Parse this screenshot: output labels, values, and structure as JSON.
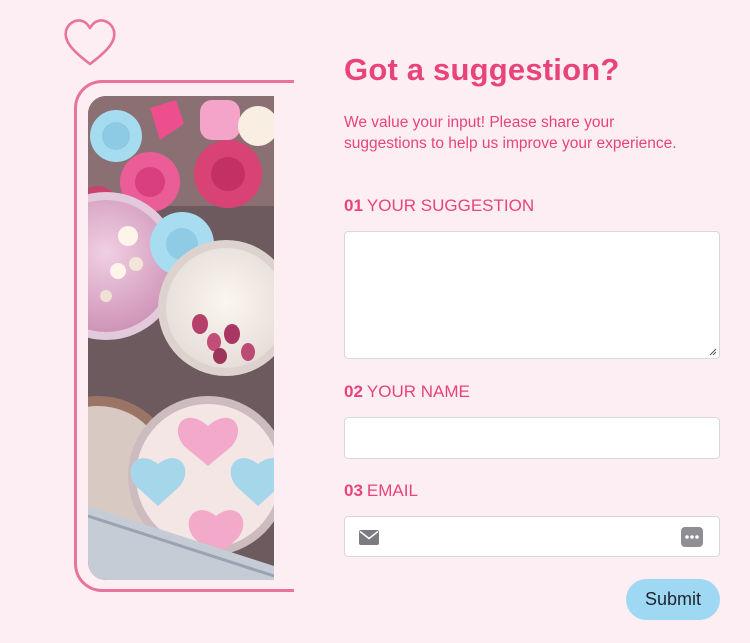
{
  "form": {
    "title": "Got a suggestion?",
    "intro_line1": "We value your input! Please share your",
    "intro_line2": "suggestions to help us improve your experience.",
    "fields": [
      {
        "number": "01",
        "label": "YOUR SUGGESTION",
        "value": ""
      },
      {
        "number": "02",
        "label": "YOUR NAME",
        "value": ""
      },
      {
        "number": "03",
        "label": "EMAIL",
        "value": ""
      }
    ],
    "submit_label": "Submit"
  },
  "icons": {
    "heart": "heart-icon",
    "mail": "mail-icon",
    "autofill": "autofill-key-icon"
  },
  "colors": {
    "background": "#fdeef3",
    "accent": "#e8437b",
    "frame": "#e97399",
    "button": "#9fd8f3"
  }
}
